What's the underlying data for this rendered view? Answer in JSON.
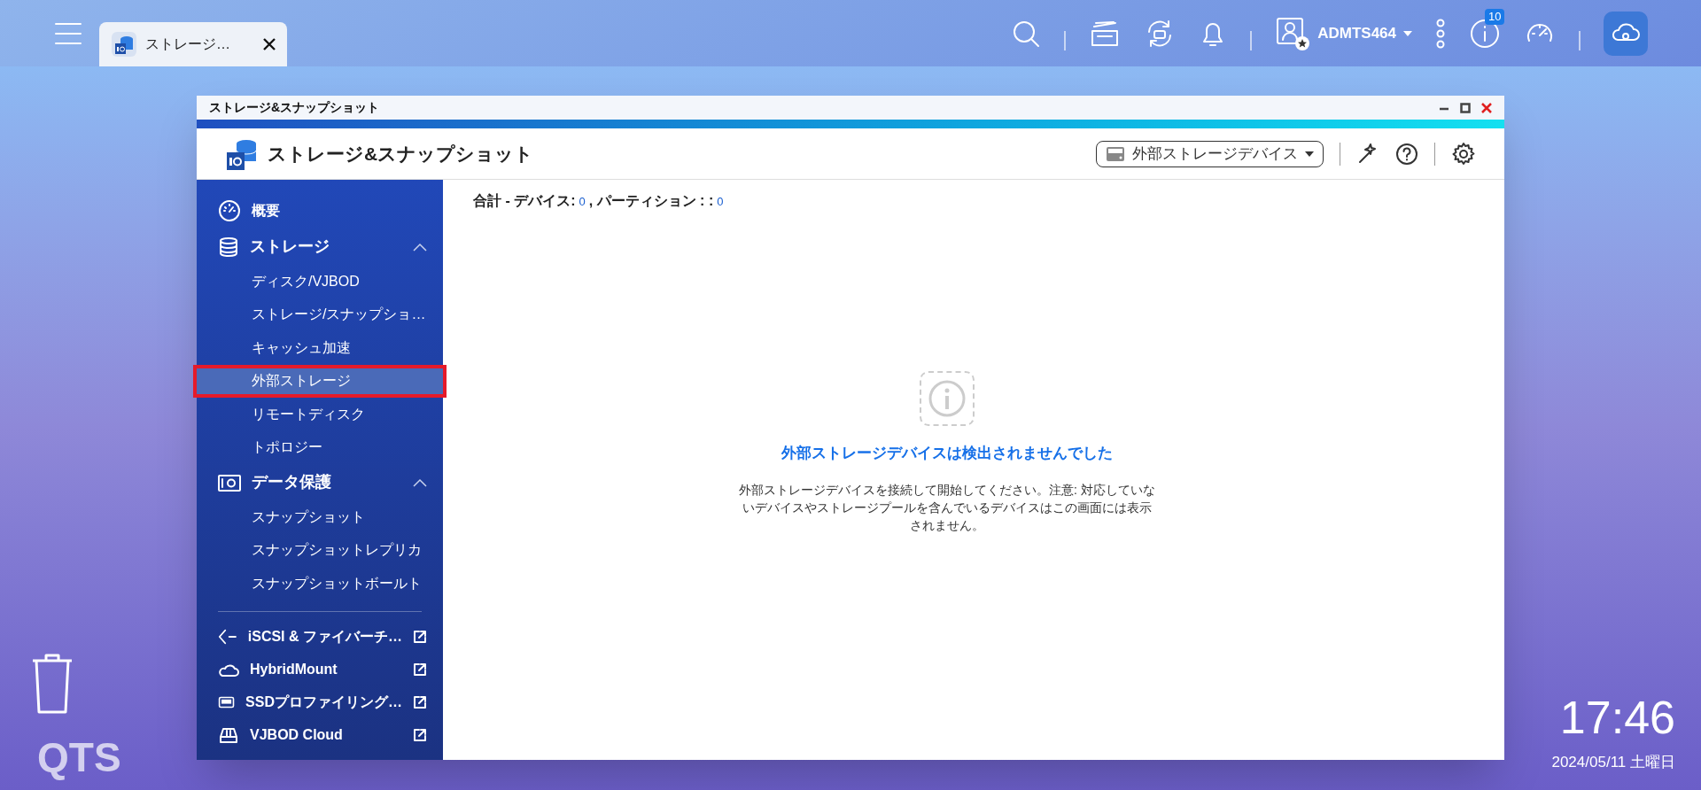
{
  "taskbar": {
    "tabs": [
      {
        "label": "ストレージ…",
        "selected": true
      }
    ],
    "user": "ADMTS464",
    "notification_count": "10"
  },
  "window": {
    "title": "ストレージ&スナップショット",
    "app_title": "ストレージ&スナップショット",
    "device_dropdown": "外部ストレージデバイス"
  },
  "sidebar": {
    "sections": [
      {
        "kind": "item",
        "label": "概要"
      },
      {
        "kind": "group",
        "label": "ストレージ",
        "expanded": true,
        "children": [
          {
            "label": "ディスク/VJBOD",
            "selected": false,
            "outlined": false
          },
          {
            "label": "ストレージ/スナップショ…",
            "selected": false,
            "outlined": false
          },
          {
            "label": "キャッシュ加速",
            "selected": false,
            "outlined": false
          },
          {
            "label": "外部ストレージ",
            "selected": true,
            "outlined": true
          },
          {
            "label": "リモートディスク",
            "selected": false,
            "outlined": false
          },
          {
            "label": "トポロジー",
            "selected": false,
            "outlined": false
          }
        ]
      },
      {
        "kind": "group",
        "label": "データ保護",
        "expanded": true,
        "children": [
          {
            "label": "スナップショット",
            "selected": false,
            "outlined": false
          },
          {
            "label": "スナップショットレプリカ",
            "selected": false,
            "outlined": false
          },
          {
            "label": "スナップショットボールト",
            "selected": false,
            "outlined": false
          }
        ]
      }
    ],
    "external_links": [
      {
        "label": "iSCSI & ファイバーチ…"
      },
      {
        "label": "HybridMount"
      },
      {
        "label": "SSDプロファイリング…"
      },
      {
        "label": "VJBOD Cloud"
      }
    ]
  },
  "content": {
    "summary": {
      "devices_label": "合計 - デバイス:",
      "devices": "0",
      "partitions_label": ", パーティション : :",
      "partitions": "0"
    },
    "empty_state": {
      "title": "外部ストレージデバイスは検出されませんでした",
      "message": "外部ストレージデバイスを接続して開始してください。注意: 対応していないデバイスやストレージプールを含んでいるデバイスはこの画面には表示されません。"
    }
  },
  "desktop": {
    "logo": "QTS",
    "time": "17:46",
    "date": "2024/05/11 土曜日"
  }
}
